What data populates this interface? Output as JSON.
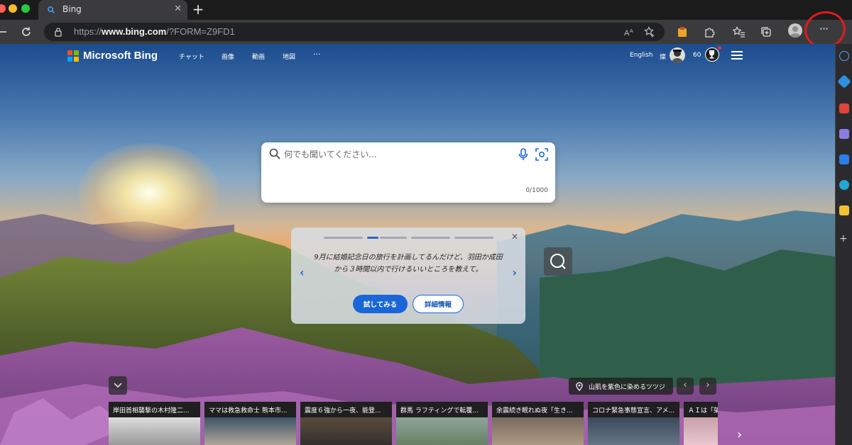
{
  "browser": {
    "tab_title": "Bing",
    "tab_close": "✕",
    "new_tab": "+",
    "url_prefix": "https://",
    "url_domain": "www.bing.com",
    "url_path": "/?FORM=Z9FD1",
    "more_label": "···"
  },
  "bing": {
    "logo_text": "Microsoft Bing",
    "nav": [
      "チャット",
      "画像",
      "動画",
      "地図",
      "···"
    ],
    "language": "English",
    "user_name": "燦",
    "points": "60"
  },
  "search": {
    "placeholder": "何でも聞いてください...",
    "counter": "0/1000"
  },
  "suggestion": {
    "text": "9月に結婚記念日の旅行を計画してるんだけど、羽田か成田から３時間以内で行けるいいところを教えて。",
    "try_label": "試してみる",
    "info_label": "詳細情報",
    "close": "✕",
    "prev": "‹",
    "next": "›"
  },
  "image_info": {
    "caption": "山肌を紫色に染めるツツジ",
    "prev": "‹",
    "next": "›"
  },
  "news": [
    {
      "headline": "岸田首相襲撃の木村隆二..."
    },
    {
      "headline": "ママは救急救命士 熊本市..."
    },
    {
      "headline": "震度６強から一夜、能登..."
    },
    {
      "headline": "群馬 ラフティングで転覆..."
    },
    {
      "headline": "余震続き眠れぬ夜「生き..."
    },
    {
      "headline": "コロナ緊急事態宣言、アメ..."
    },
    {
      "headline": "ＡＩは「架"
    }
  ],
  "colors": {
    "accent": "#1a66d8",
    "annotation": "#e21b1b"
  }
}
